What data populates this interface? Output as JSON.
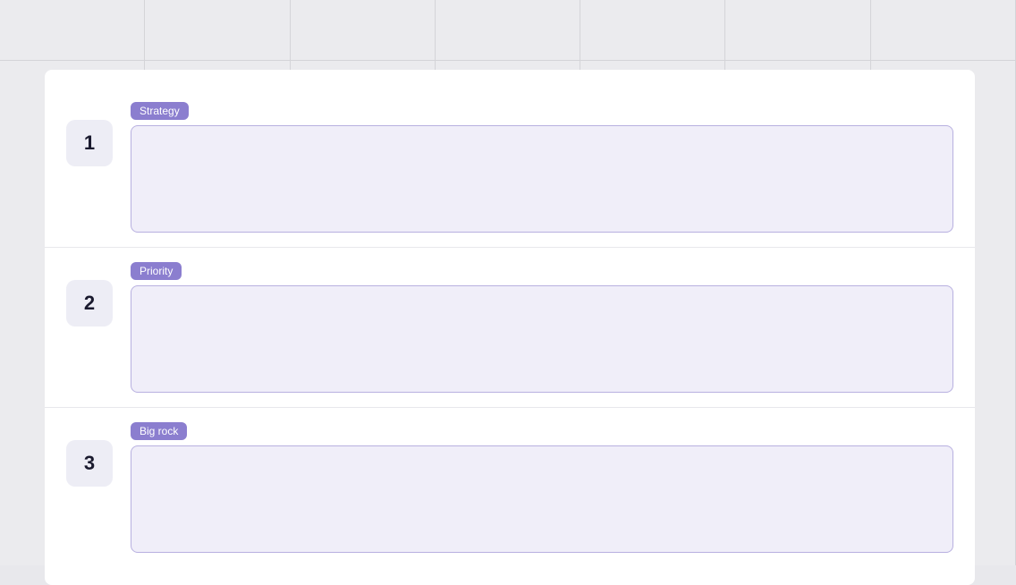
{
  "grid": {
    "columns": 7
  },
  "rows": [
    {
      "number": "1",
      "label": "Strategy"
    },
    {
      "number": "2",
      "label": "Priority"
    },
    {
      "number": "3",
      "label": "Big rock"
    }
  ]
}
